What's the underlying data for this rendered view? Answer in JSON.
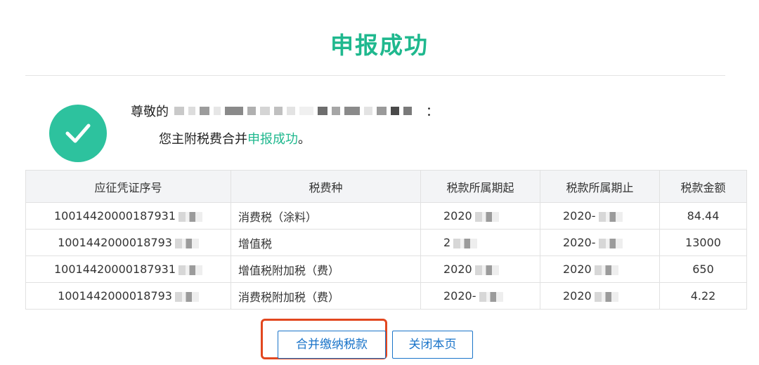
{
  "page": {
    "title": "申报成功",
    "greeting_prefix": "尊敬的",
    "greeting_suffix": "：",
    "message_prefix": "您主附税费合并",
    "message_highlight": "申报成功",
    "message_suffix": "。"
  },
  "colors": {
    "accent_green": "#1fb88e",
    "badge_green": "#2dc29e",
    "button_blue": "#1a74c9",
    "highlight_red": "#e2471f",
    "redaction": "#7f7f7f"
  },
  "icons": {
    "success": "check-icon"
  },
  "table": {
    "headers": [
      "应征凭证序号",
      "税费种",
      "税款所属期起",
      "税款所属期止",
      "税款金额"
    ],
    "rows": [
      [
        "10014420000187931",
        "消费税（涂料）",
        "2020",
        "2020-",
        "84.44"
      ],
      [
        "1001442000018793",
        "增值税",
        "2",
        "2020-",
        "13000"
      ],
      [
        "10014420000187931",
        "增值税附加税（费）",
        "2020",
        "2020",
        "650"
      ],
      [
        "1001442000018793",
        "消费税附加税（费）",
        "2020-",
        "2020",
        "4.22"
      ]
    ]
  },
  "buttons": {
    "merge_pay": "合并缴纳税款",
    "close_page": "关闭本页"
  }
}
